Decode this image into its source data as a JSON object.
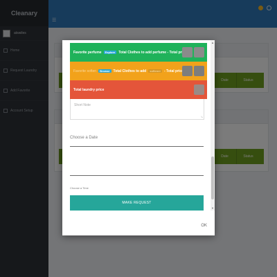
{
  "app": {
    "brand": "Cleanary",
    "user_name": "atswiles"
  },
  "sidebar": {
    "items": [
      {
        "label": "Home",
        "icon": "home-icon"
      },
      {
        "label": "Request Laundry",
        "icon": "basket-icon"
      },
      {
        "label": "Add Favorite",
        "icon": "heart-icon"
      },
      {
        "label": "Account Setup",
        "icon": "user-icon"
      }
    ]
  },
  "background": {
    "row_buttons": [
      "Date",
      "Status"
    ]
  },
  "modal": {
    "bars": {
      "favorite_perfume": {
        "lead": "Favorite perfume",
        "tag": "Explore",
        "text": "Total Clothes to add perfume - Total price"
      },
      "favorite_softener": {
        "lead": "Favorite soften",
        "tag": "Browse",
        "text": "Total Clothes to add",
        "tag2": "softener",
        "tail": "- Total price"
      },
      "total_laundry": {
        "lead": "Total laundry price"
      }
    },
    "note_placeholder": "Short Note",
    "date_label": "Choose a Date",
    "time_label": "Choose a Time",
    "make_request": "MAKE REQUEST",
    "ok": "OK"
  },
  "colors": {
    "topbar": "#2f77b6",
    "green_bar": "#1fb25a",
    "orange_bar": "#f2a21b",
    "red_bar": "#e4553a",
    "make_request": "#26a69a"
  }
}
